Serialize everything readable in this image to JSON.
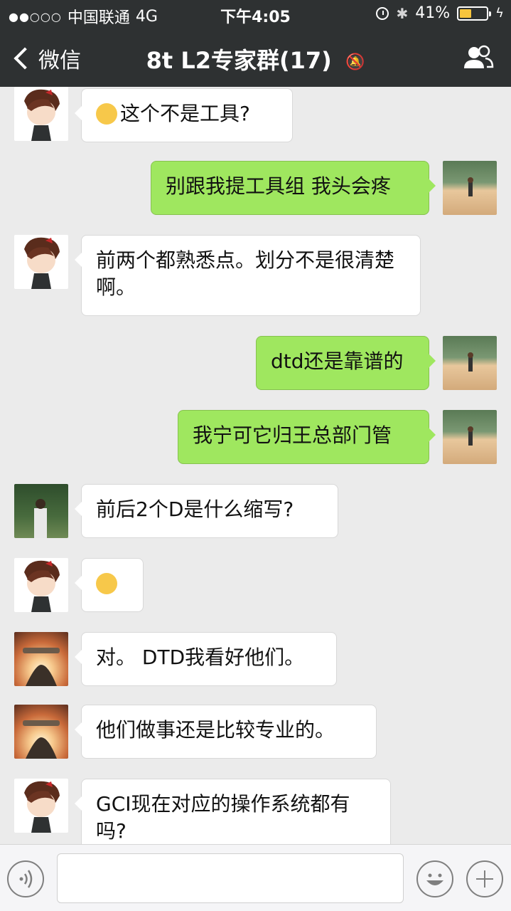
{
  "status_bar": {
    "carrier": "中国联通",
    "network": "4G",
    "time": "下午4:05",
    "battery": "41%"
  },
  "nav": {
    "back_label": "微信",
    "title": "8t L2专家群(17)"
  },
  "messages": [
    {
      "side": "in",
      "avatar": "cartoon-avatar",
      "text": "这个不是工具?"
    },
    {
      "side": "out",
      "avatar": "beach-photo-avatar",
      "text": "别跟我提工具组 我头会疼"
    },
    {
      "side": "in",
      "avatar": "cartoon-avatar",
      "text": "前两个都熟悉点。划分不是很清楚啊。"
    },
    {
      "side": "out",
      "avatar": "beach-photo-avatar",
      "text": "dtd还是靠谱的"
    },
    {
      "side": "out",
      "avatar": "beach-photo-avatar",
      "text": "我宁可它归王总部门管"
    },
    {
      "side": "in",
      "avatar": "forest-photo-avatar",
      "text": "前后2个D是什么缩写?"
    },
    {
      "side": "in",
      "avatar": "cartoon-avatar",
      "text": ""
    },
    {
      "side": "in",
      "avatar": "sunset-photo-avatar",
      "text": "对。 DTD我看好他们。"
    },
    {
      "side": "in",
      "avatar": "sunset-photo-avatar",
      "text": "他们做事还是比较专业的。"
    },
    {
      "side": "in",
      "avatar": "cartoon-avatar",
      "text": "GCI现在对应的操作系统都有吗?"
    }
  ],
  "colors": {
    "nav_bg": "#2e3132",
    "chat_bg": "#ebebeb",
    "bubble_out": "#9fe75f",
    "bubble_in": "#ffffff"
  }
}
